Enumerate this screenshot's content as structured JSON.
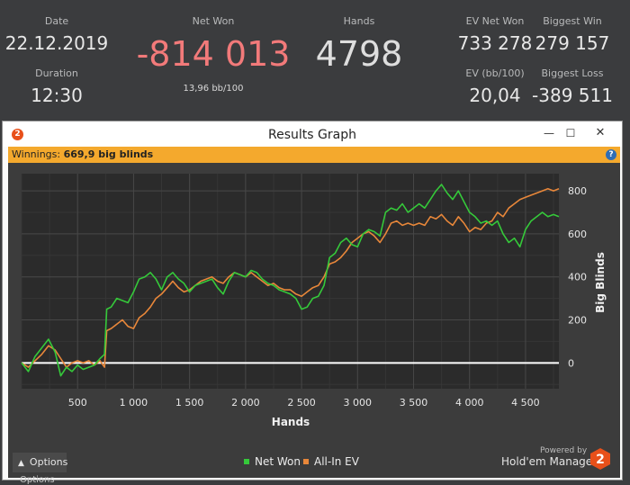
{
  "stats": {
    "date_label": "Date",
    "date_value": "22.12.2019",
    "duration_label": "Duration",
    "duration_value": "12:30",
    "net_won_label": "Net Won",
    "net_won_value": "-814 013",
    "net_won_rate": "13,96 bb/100",
    "hands_label": "Hands",
    "hands_value": "4798",
    "ev_net_won_label": "EV Net Won",
    "ev_net_won_value": "733 278",
    "ev_bb_label": "EV (bb/100)",
    "ev_bb_value": "20,04",
    "biggest_win_label": "Biggest Win",
    "biggest_win_value": "279 157",
    "biggest_loss_label": "Biggest Loss",
    "biggest_loss_value": "-389 511"
  },
  "window": {
    "title": "Results Graph",
    "app_icon_glyph": "2",
    "minimize_glyph": "—",
    "maximize_glyph": "☐",
    "close_glyph": "✕"
  },
  "infobar": {
    "label": "Winnings:",
    "value": "669,9 big blinds",
    "help_glyph": "?"
  },
  "footer": {
    "options_label": "Options",
    "options_ghost": "Options",
    "powered_by": "Powered by",
    "brand": "Hold'em Manager",
    "brand_logo_glyph": "2"
  },
  "colors": {
    "net_won": "#35c93a",
    "all_in_ev": "#e8873a",
    "accent_bar": "#f4a92d",
    "negative": "#f27a7a"
  },
  "chart_data": {
    "type": "line",
    "xlabel": "Hands",
    "ylabel": "Big Blinds",
    "xlim": [
      0,
      4798
    ],
    "ylim": [
      -120,
      880
    ],
    "x_ticks": [
      500,
      1000,
      1500,
      2000,
      2500,
      3000,
      3500,
      4000,
      4500
    ],
    "x_tick_labels": [
      "500",
      "1 000",
      "1 500",
      "2 000",
      "2 500",
      "3 000",
      "3 500",
      "4 000",
      "4 500"
    ],
    "y_ticks": [
      0,
      200,
      400,
      600,
      800
    ],
    "y_tick_labels": [
      "0",
      "200",
      "400",
      "600",
      "800"
    ],
    "grid": true,
    "legend": "bottom-center",
    "series": [
      {
        "name": "Net Won",
        "color": "#35c93a",
        "x": [
          0,
          60,
          120,
          180,
          240,
          300,
          350,
          400,
          450,
          500,
          550,
          600,
          650,
          700,
          740,
          760,
          800,
          850,
          900,
          950,
          1000,
          1050,
          1100,
          1150,
          1200,
          1250,
          1300,
          1350,
          1400,
          1450,
          1500,
          1550,
          1600,
          1650,
          1700,
          1750,
          1800,
          1850,
          1900,
          1950,
          2000,
          2050,
          2100,
          2150,
          2200,
          2250,
          2300,
          2350,
          2400,
          2450,
          2500,
          2550,
          2600,
          2650,
          2700,
          2750,
          2800,
          2850,
          2900,
          2950,
          3000,
          3050,
          3100,
          3150,
          3200,
          3250,
          3300,
          3350,
          3400,
          3450,
          3500,
          3550,
          3600,
          3650,
          3700,
          3750,
          3800,
          3850,
          3900,
          3950,
          4000,
          4050,
          4100,
          4150,
          4200,
          4250,
          4300,
          4350,
          4400,
          4450,
          4500,
          4550,
          4600,
          4650,
          4700,
          4750,
          4798
        ],
        "y": [
          0,
          -40,
          30,
          70,
          110,
          50,
          -60,
          -20,
          -40,
          -10,
          -30,
          -20,
          -10,
          20,
          40,
          250,
          260,
          300,
          290,
          280,
          330,
          390,
          400,
          420,
          390,
          340,
          400,
          420,
          390,
          370,
          330,
          360,
          370,
          380,
          390,
          350,
          320,
          380,
          420,
          410,
          400,
          430,
          420,
          390,
          370,
          360,
          340,
          330,
          320,
          300,
          250,
          260,
          300,
          310,
          360,
          490,
          510,
          560,
          580,
          550,
          540,
          600,
          620,
          610,
          590,
          700,
          720,
          710,
          740,
          700,
          720,
          740,
          720,
          760,
          800,
          830,
          790,
          760,
          800,
          750,
          700,
          680,
          650,
          660,
          640,
          660,
          600,
          560,
          580,
          540,
          620,
          660,
          680,
          700,
          680,
          690,
          680
        ]
      },
      {
        "name": "All-In EV",
        "color": "#e8873a",
        "x": [
          0,
          60,
          120,
          180,
          240,
          300,
          350,
          400,
          450,
          500,
          550,
          600,
          650,
          700,
          740,
          760,
          800,
          850,
          900,
          950,
          1000,
          1050,
          1100,
          1150,
          1200,
          1250,
          1300,
          1350,
          1400,
          1450,
          1500,
          1550,
          1600,
          1650,
          1700,
          1750,
          1800,
          1850,
          1900,
          1950,
          2000,
          2050,
          2100,
          2150,
          2200,
          2250,
          2300,
          2350,
          2400,
          2450,
          2500,
          2550,
          2600,
          2650,
          2700,
          2750,
          2800,
          2850,
          2900,
          2950,
          3000,
          3050,
          3100,
          3150,
          3200,
          3250,
          3300,
          3350,
          3400,
          3450,
          3500,
          3550,
          3600,
          3650,
          3700,
          3750,
          3800,
          3850,
          3900,
          3950,
          4000,
          4050,
          4100,
          4150,
          4200,
          4250,
          4300,
          4350,
          4400,
          4450,
          4500,
          4550,
          4600,
          4650,
          4700,
          4750,
          4798
        ],
        "y": [
          0,
          -20,
          10,
          40,
          80,
          60,
          20,
          -20,
          0,
          10,
          0,
          10,
          -10,
          10,
          -20,
          150,
          160,
          180,
          200,
          170,
          160,
          210,
          230,
          260,
          300,
          320,
          350,
          380,
          350,
          330,
          340,
          360,
          380,
          390,
          400,
          380,
          370,
          400,
          420,
          410,
          400,
          420,
          400,
          380,
          360,
          370,
          350,
          340,
          340,
          320,
          310,
          330,
          350,
          360,
          400,
          460,
          470,
          490,
          520,
          560,
          580,
          600,
          610,
          590,
          560,
          600,
          650,
          660,
          640,
          650,
          640,
          650,
          640,
          680,
          670,
          690,
          660,
          640,
          680,
          650,
          610,
          630,
          620,
          650,
          660,
          700,
          680,
          720,
          740,
          760,
          770,
          780,
          790,
          800,
          810,
          800,
          810
        ]
      }
    ]
  }
}
